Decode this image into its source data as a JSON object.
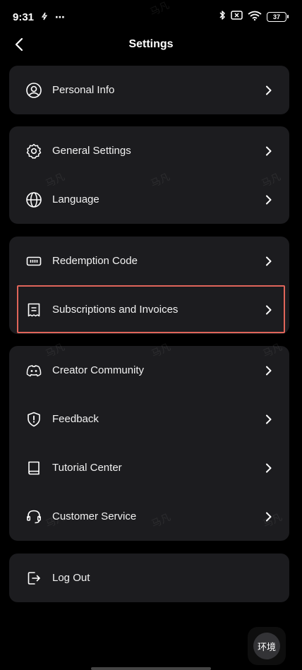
{
  "status_bar": {
    "time": "9:31",
    "extra": "⋯",
    "battery": "37"
  },
  "header": {
    "title": "Settings"
  },
  "groups": [
    [
      {
        "label": "Personal Info",
        "icon": "user-circle-icon"
      }
    ],
    [
      {
        "label": "General Settings",
        "icon": "gear-icon"
      },
      {
        "label": "Language",
        "icon": "globe-icon"
      }
    ],
    [
      {
        "label": "Redemption Code",
        "icon": "ticket-icon"
      },
      {
        "label": "Subscriptions and Invoices",
        "icon": "receipt-icon"
      }
    ],
    [
      {
        "label": "Creator Community",
        "icon": "discord-icon"
      },
      {
        "label": "Feedback",
        "icon": "shield-alert-icon"
      },
      {
        "label": "Tutorial Center",
        "icon": "book-icon"
      },
      {
        "label": "Customer Service",
        "icon": "headset-icon"
      }
    ],
    [
      {
        "label": "Log Out",
        "icon": "logout-icon"
      }
    ]
  ],
  "watermark_text": "马凡",
  "float_button": {
    "label": "环境"
  },
  "colors": {
    "background": "#000000",
    "card": "#1c1c1f",
    "highlight": "#e0655a"
  }
}
